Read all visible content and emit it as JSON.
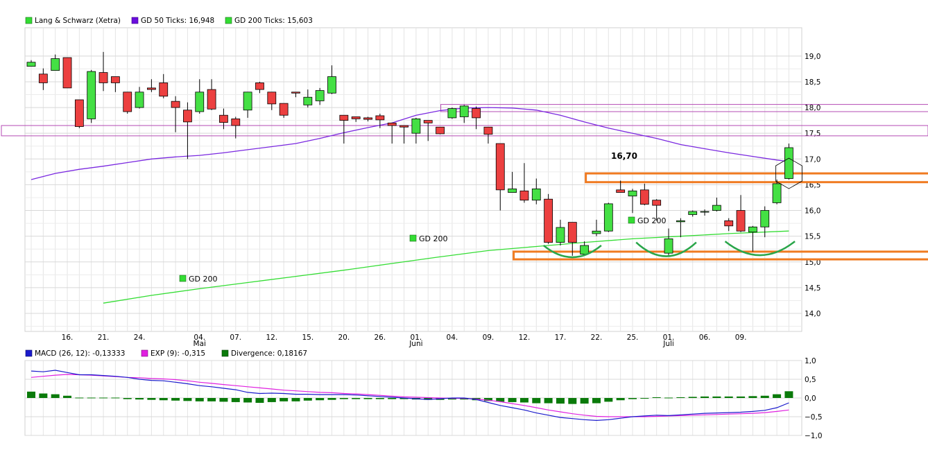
{
  "chart_data": [
    {
      "type": "candlestick",
      "legend": [
        {
          "label": "Lang & Schwarz (Xetra)",
          "color": "#33dd33"
        },
        {
          "label": "GD 50 Ticks: 16,948",
          "color": "#6a0ddd"
        },
        {
          "label": "GD 200 Ticks: 15,603",
          "color": "#33dd33"
        }
      ],
      "y_ticks": [
        "19,0",
        "18,5",
        "18,0",
        "17,5",
        "17,0",
        "16,5",
        "16,0",
        "15,5",
        "15,0",
        "14,5",
        "14,0"
      ],
      "y_tick_values": [
        19.0,
        18.5,
        18.0,
        17.5,
        17.0,
        16.5,
        16.0,
        15.5,
        15.0,
        14.5,
        14.0
      ],
      "ylim": [
        13.65,
        19.55
      ],
      "x_ticks": [
        {
          "label": "16.",
          "i": 3
        },
        {
          "label": "21.",
          "i": 6
        },
        {
          "label": "24.",
          "i": 9
        },
        {
          "label": "04.",
          "i": 14,
          "month": "Mai"
        },
        {
          "label": "07.",
          "i": 17
        },
        {
          "label": "12.",
          "i": 20
        },
        {
          "label": "15.",
          "i": 23
        },
        {
          "label": "20.",
          "i": 26
        },
        {
          "label": "26.",
          "i": 29
        },
        {
          "label": "01.",
          "i": 32,
          "month": "Juni"
        },
        {
          "label": "04.",
          "i": 35
        },
        {
          "label": "09.",
          "i": 38
        },
        {
          "label": "12.",
          "i": 41
        },
        {
          "label": "17.",
          "i": 44
        },
        {
          "label": "22.",
          "i": 47
        },
        {
          "label": "25.",
          "i": 50
        },
        {
          "label": "01.",
          "i": 53,
          "month": "Juli"
        },
        {
          "label": "06.",
          "i": 56
        },
        {
          "label": "09.",
          "i": 59
        }
      ],
      "candles": [
        [
          18.8,
          18.92,
          18.83,
          18.88
        ],
        [
          18.65,
          18.76,
          18.34,
          18.48
        ],
        [
          18.72,
          19.03,
          18.72,
          18.95
        ],
        [
          18.97,
          18.97,
          18.38,
          18.38
        ],
        [
          18.15,
          18.15,
          17.6,
          17.63
        ],
        [
          17.78,
          18.73,
          17.7,
          18.7
        ],
        [
          18.68,
          19.08,
          18.32,
          18.48
        ],
        [
          18.6,
          18.6,
          18.3,
          18.48
        ],
        [
          18.3,
          18.3,
          17.88,
          17.92
        ],
        [
          18.0,
          18.4,
          17.98,
          18.3
        ],
        [
          18.38,
          18.55,
          18.3,
          18.35
        ],
        [
          18.48,
          18.65,
          18.18,
          18.22
        ],
        [
          18.12,
          18.22,
          17.52,
          18.0
        ],
        [
          17.95,
          18.1,
          17.0,
          17.72
        ],
        [
          17.92,
          18.55,
          17.88,
          18.3
        ],
        [
          18.35,
          18.55,
          17.95,
          17.97
        ],
        [
          17.85,
          17.98,
          17.58,
          17.71
        ],
        [
          17.78,
          17.82,
          17.4,
          17.65
        ],
        [
          17.95,
          18.3,
          17.8,
          18.3
        ],
        [
          18.48,
          18.5,
          18.28,
          18.35
        ],
        [
          18.3,
          18.3,
          17.95,
          18.07
        ],
        [
          18.08,
          18.08,
          17.8,
          17.85
        ],
        [
          18.3,
          18.3,
          18.2,
          18.28
        ],
        [
          18.05,
          18.35,
          18.0,
          18.2
        ],
        [
          18.13,
          18.38,
          18.05,
          18.33
        ],
        [
          18.28,
          18.82,
          18.26,
          18.6
        ],
        [
          17.85,
          17.85,
          17.3,
          17.75
        ],
        [
          17.82,
          17.82,
          17.72,
          17.78
        ],
        [
          17.8,
          17.82,
          17.73,
          17.77
        ],
        [
          17.84,
          17.88,
          17.6,
          17.76
        ],
        [
          17.7,
          17.7,
          17.3,
          17.65
        ],
        [
          17.65,
          17.65,
          17.3,
          17.62
        ],
        [
          17.5,
          17.8,
          17.3,
          17.78
        ],
        [
          17.75,
          17.75,
          17.35,
          17.7
        ],
        [
          17.62,
          17.62,
          17.48,
          17.49
        ],
        [
          17.8,
          18.0,
          17.78,
          17.98
        ],
        [
          17.82,
          18.05,
          17.7,
          18.03
        ],
        [
          17.98,
          18.02,
          17.58,
          17.8
        ],
        [
          17.62,
          17.62,
          17.3,
          17.48
        ],
        [
          17.3,
          17.3,
          16.0,
          16.4
        ],
        [
          16.35,
          16.75,
          16.35,
          16.42
        ],
        [
          16.38,
          16.92,
          16.15,
          16.2
        ],
        [
          16.2,
          16.62,
          16.12,
          16.42
        ],
        [
          16.22,
          16.32,
          15.35,
          15.38
        ],
        [
          15.38,
          15.82,
          15.32,
          15.67
        ],
        [
          15.77,
          15.77,
          15.12,
          15.38
        ],
        [
          15.15,
          15.4,
          15.12,
          15.32
        ],
        [
          15.55,
          15.82,
          15.5,
          15.6
        ],
        [
          15.6,
          16.15,
          15.58,
          16.13
        ],
        [
          16.4,
          16.58,
          16.35,
          16.35
        ],
        [
          16.28,
          16.42,
          15.95,
          16.38
        ],
        [
          16.4,
          16.52,
          16.1,
          16.12
        ],
        [
          16.2,
          16.22,
          15.8,
          16.1
        ],
        [
          15.17,
          15.65,
          15.12,
          15.45
        ],
        [
          15.78,
          15.85,
          15.48,
          15.8
        ],
        [
          15.92,
          16.0,
          15.88,
          15.98
        ],
        [
          15.97,
          16.02,
          15.9,
          15.98
        ],
        [
          16.0,
          16.25,
          15.98,
          16.1
        ],
        [
          15.8,
          15.85,
          15.6,
          15.7
        ],
        [
          16.0,
          16.3,
          15.58,
          15.6
        ],
        [
          15.58,
          15.7,
          15.2,
          15.68
        ],
        [
          15.68,
          16.08,
          15.48,
          16.0
        ],
        [
          16.15,
          16.6,
          16.12,
          16.52
        ],
        [
          16.62,
          17.3,
          16.6,
          17.22
        ]
      ],
      "gd50": [
        [
          0,
          16.6
        ],
        [
          2,
          16.72
        ],
        [
          4,
          16.8
        ],
        [
          6,
          16.86
        ],
        [
          8,
          16.93
        ],
        [
          10,
          17.0
        ],
        [
          12,
          17.04
        ],
        [
          14,
          17.07
        ],
        [
          16,
          17.12
        ],
        [
          18,
          17.18
        ],
        [
          20,
          17.24
        ],
        [
          22,
          17.3
        ],
        [
          24,
          17.4
        ],
        [
          26,
          17.51
        ],
        [
          28,
          17.61
        ],
        [
          30,
          17.7
        ],
        [
          32,
          17.85
        ],
        [
          34,
          17.94
        ],
        [
          36,
          17.99
        ],
        [
          38,
          18.0
        ],
        [
          40,
          17.99
        ],
        [
          42,
          17.95
        ],
        [
          44,
          17.85
        ],
        [
          46,
          17.72
        ],
        [
          48,
          17.6
        ],
        [
          50,
          17.5
        ],
        [
          52,
          17.4
        ],
        [
          54,
          17.28
        ],
        [
          56,
          17.2
        ],
        [
          58,
          17.12
        ],
        [
          60,
          17.05
        ],
        [
          62,
          16.98
        ],
        [
          63,
          16.95
        ]
      ],
      "gd200": [
        [
          6,
          14.2
        ],
        [
          10,
          14.35
        ],
        [
          14,
          14.48
        ],
        [
          18,
          14.6
        ],
        [
          22,
          14.72
        ],
        [
          26,
          14.84
        ],
        [
          30,
          14.97
        ],
        [
          34,
          15.1
        ],
        [
          38,
          15.22
        ],
        [
          42,
          15.3
        ],
        [
          46,
          15.38
        ],
        [
          50,
          15.45
        ],
        [
          54,
          15.5
        ],
        [
          58,
          15.55
        ],
        [
          63,
          15.6
        ]
      ],
      "annotations": [
        {
          "text": "16,70"
        },
        {
          "text": "GD 200"
        },
        {
          "text": "GD 200"
        },
        {
          "text": "GD 200"
        }
      ],
      "resistance_zone": [
        17.45,
        17.65
      ],
      "resistance_zone_2": [
        17.92,
        18.06
      ],
      "support_zone": [
        15.05,
        15.2
      ],
      "breakout_zone": [
        16.55,
        16.72
      ]
    },
    {
      "type": "line",
      "legend": [
        {
          "label": "MACD (26, 12): -0,13333",
          "color": "#1a1acc"
        },
        {
          "label": "EXP (9): -0,315",
          "color": "#e020e0"
        },
        {
          "label": "Divergence: 0,18167",
          "color": "#0a7a0a"
        }
      ],
      "y_ticks": [
        "1,0",
        "0,5",
        "0,0",
        "−0,5",
        "−1,0"
      ],
      "y_tick_values": [
        1.0,
        0.5,
        0.0,
        -0.5,
        -1.0
      ],
      "ylim": [
        -1.0,
        1.0
      ],
      "macd": [
        0.72,
        0.7,
        0.74,
        0.68,
        0.62,
        0.62,
        0.6,
        0.58,
        0.55,
        0.5,
        0.47,
        0.46,
        0.42,
        0.38,
        0.33,
        0.3,
        0.26,
        0.22,
        0.15,
        0.12,
        0.13,
        0.12,
        0.1,
        0.1,
        0.09,
        0.09,
        0.09,
        0.08,
        0.06,
        0.04,
        0.02,
        0.0,
        -0.02,
        -0.04,
        -0.02,
        0.0,
        0.0,
        -0.04,
        -0.12,
        -0.2,
        -0.26,
        -0.32,
        -0.4,
        -0.46,
        -0.52,
        -0.55,
        -0.58,
        -0.6,
        -0.58,
        -0.54,
        -0.5,
        -0.48,
        -0.46,
        -0.47,
        -0.45,
        -0.43,
        -0.41,
        -0.4,
        -0.39,
        -0.38,
        -0.36,
        -0.33,
        -0.26,
        -0.13
      ],
      "exp": [
        0.55,
        0.58,
        0.61,
        0.63,
        0.62,
        0.61,
        0.59,
        0.57,
        0.55,
        0.54,
        0.52,
        0.51,
        0.49,
        0.46,
        0.42,
        0.39,
        0.36,
        0.33,
        0.3,
        0.27,
        0.24,
        0.21,
        0.19,
        0.17,
        0.15,
        0.14,
        0.12,
        0.11,
        0.09,
        0.07,
        0.05,
        0.03,
        0.02,
        0.01,
        0.0,
        -0.01,
        -0.01,
        -0.03,
        -0.06,
        -0.1,
        -0.15,
        -0.2,
        -0.26,
        -0.32,
        -0.37,
        -0.42,
        -0.46,
        -0.49,
        -0.5,
        -0.5,
        -0.5,
        -0.5,
        -0.49,
        -0.48,
        -0.47,
        -0.46,
        -0.45,
        -0.44,
        -0.43,
        -0.42,
        -0.41,
        -0.39,
        -0.36,
        -0.32
      ],
      "divergence": [
        0.17,
        0.12,
        0.1,
        0.06,
        0.01,
        0.01,
        0.01,
        0.01,
        -0.03,
        -0.04,
        -0.05,
        -0.06,
        -0.07,
        -0.08,
        -0.09,
        -0.09,
        -0.1,
        -0.11,
        -0.12,
        -0.13,
        -0.11,
        -0.09,
        -0.09,
        -0.07,
        -0.06,
        -0.05,
        -0.03,
        -0.03,
        -0.03,
        -0.03,
        -0.03,
        -0.03,
        -0.04,
        -0.05,
        -0.05,
        -0.04,
        -0.04,
        -0.06,
        -0.08,
        -0.1,
        -0.11,
        -0.12,
        -0.14,
        -0.14,
        -0.15,
        -0.16,
        -0.15,
        -0.14,
        -0.1,
        -0.06,
        -0.03,
        -0.01,
        0.02,
        0.01,
        0.02,
        0.03,
        0.04,
        0.04,
        0.04,
        0.04,
        0.05,
        0.06,
        0.1,
        0.18
      ]
    }
  ]
}
